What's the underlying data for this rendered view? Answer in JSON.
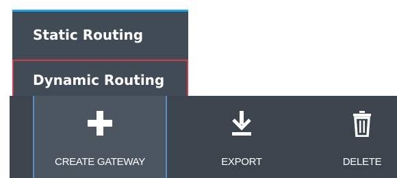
{
  "menu": {
    "items": [
      {
        "label": "Static Routing"
      },
      {
        "label": "Dynamic Routing",
        "highlighted": true
      }
    ],
    "accent_color": "#1aa9e6",
    "highlight_color": "#d23a4a"
  },
  "toolbar": {
    "buttons": [
      {
        "label": "CREATE GATEWAY",
        "icon": "plus-icon",
        "selected": true
      },
      {
        "label": "EXPORT",
        "icon": "download-icon"
      },
      {
        "label": "DELETE",
        "icon": "trash-icon"
      }
    ]
  },
  "colors": {
    "menu_background": "#414b55",
    "toolbar_background": "#3c454e",
    "selected_button_background": "#4b5661",
    "selected_button_border": "#5b8fc7"
  }
}
